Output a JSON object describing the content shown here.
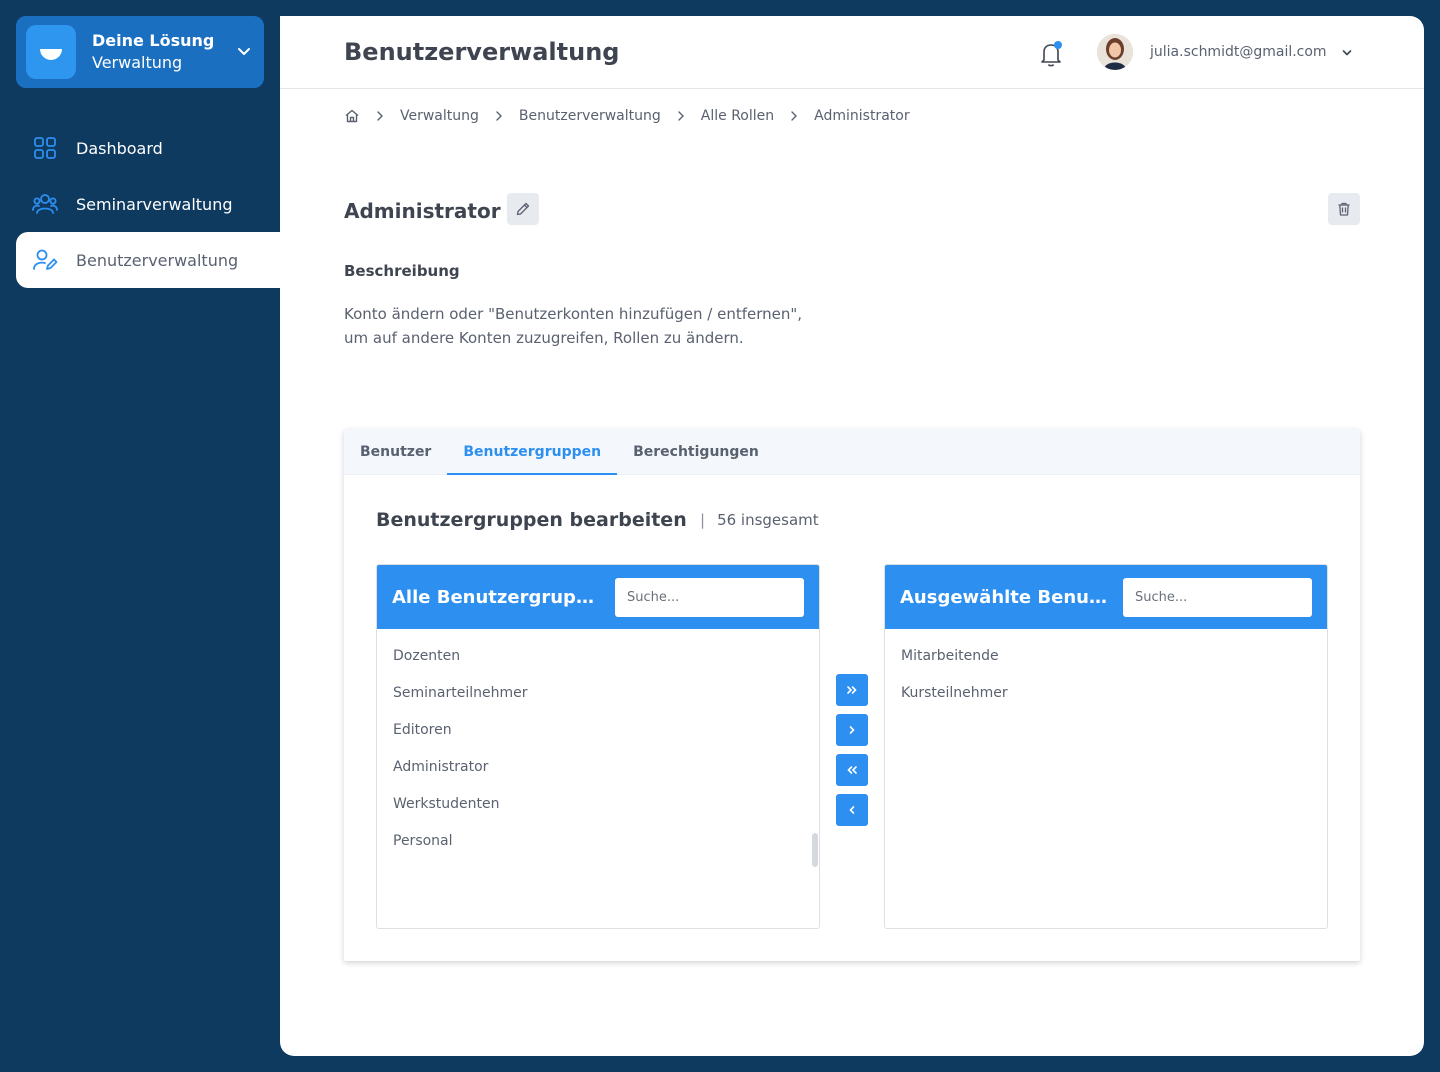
{
  "brand": {
    "title": "Deine Lösung",
    "subtitle": "Verwaltung"
  },
  "nav": [
    {
      "label": "Dashboard",
      "icon": "grid-icon"
    },
    {
      "label": "Seminarverwaltung",
      "icon": "users-icon"
    },
    {
      "label": "Benutzerverwaltung",
      "icon": "user-edit-icon",
      "active": true
    }
  ],
  "header": {
    "title": "Benutzerverwaltung",
    "user_email": "julia.schmidt@gmail.com"
  },
  "breadcrumb": [
    "Verwaltung",
    "Benutzerverwaltung",
    "Alle Rollen",
    "Administrator"
  ],
  "role": {
    "title": "Administrator",
    "description_label": "Beschreibung",
    "description_line1": "Konto ändern oder \"Benutzerkonten hinzufügen / entfernen\",",
    "description_line2": "um auf andere Konten zuzugreifen, Rollen zu ändern."
  },
  "tabs": [
    "Benutzer",
    "Benutzergruppen",
    "Berechtigungen"
  ],
  "active_tab": "Benutzergruppen",
  "panel": {
    "title": "Benutzergruppen bearbeiten",
    "separator": "|",
    "count": "56 insgesamt",
    "left": {
      "title": "Alle Benutzergruppen",
      "search_placeholder": "Suche...",
      "items": [
        "Dozenten",
        "Seminarteilnehmer",
        "Editoren",
        "Administrator",
        "Werkstudenten",
        "Personal"
      ]
    },
    "right": {
      "title": "Ausgewählte Benu...",
      "search_placeholder": "Suche...",
      "items": [
        "Mitarbeitende",
        "Kursteilnehmer"
      ]
    }
  },
  "colors": {
    "sidebar": "#0f3a60",
    "accent": "#2d8ff0",
    "brand_box": "#1a6fc1"
  }
}
